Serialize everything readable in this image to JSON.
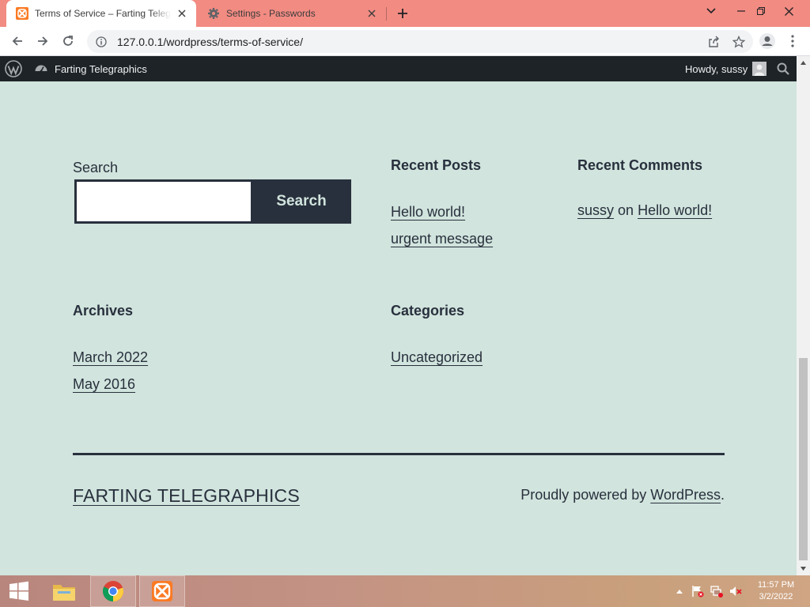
{
  "browser": {
    "tabs": [
      {
        "title": "Terms of Service – Farting Telegraphics",
        "active": true
      },
      {
        "title": "Settings - Passwords",
        "active": false
      }
    ],
    "url": "127.0.0.1/wordpress/terms-of-service/"
  },
  "adminbar": {
    "site_name": "Farting Telegraphics",
    "greeting": "Howdy, sussy"
  },
  "search_widget": {
    "label": "Search",
    "value": "",
    "button_label": "Search"
  },
  "recent_posts": {
    "title": "Recent Posts",
    "items": [
      "Hello world!",
      "urgent message"
    ]
  },
  "recent_comments": {
    "title": "Recent Comments",
    "author": "sussy",
    "connector": "on",
    "post": "Hello world!"
  },
  "archives": {
    "title": "Archives",
    "items": [
      "March 2022",
      "May 2016"
    ]
  },
  "categories": {
    "title": "Categories",
    "items": [
      "Uncategorized"
    ]
  },
  "footer": {
    "site_title": "FARTING TELEGRAPHICS",
    "powered_prefix": "Proudly powered by ",
    "powered_link": "WordPress",
    "powered_suffix": "."
  },
  "taskbar": {
    "time": "11:57 PM",
    "date": "3/2/2022"
  },
  "colors": {
    "page_bg": "#d1e4dd",
    "text": "#28303d",
    "tabstrip": "#f28b82",
    "adminbar": "#1d2327"
  }
}
